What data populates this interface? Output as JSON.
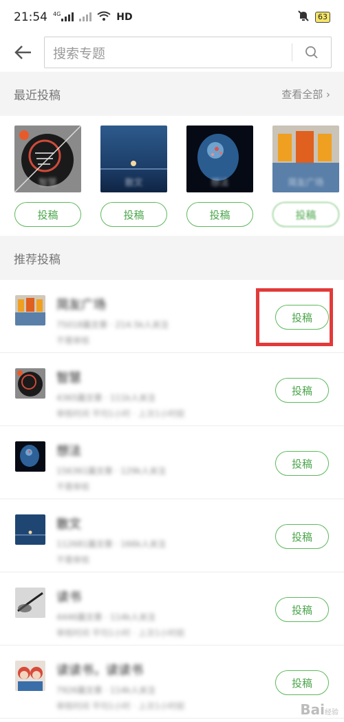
{
  "status_bar": {
    "time": "21:54",
    "network_label": "4G",
    "hd_label": "HD",
    "battery": "63"
  },
  "search": {
    "placeholder": "搜索专题"
  },
  "recent": {
    "title": "最近投稿",
    "view_all": "查看全部 ›",
    "items": [
      {
        "name": "智慧",
        "button": "投稿"
      },
      {
        "name": "散文",
        "button": "投稿"
      },
      {
        "name": "想法",
        "button": "投稿"
      },
      {
        "name": "简友广场",
        "button": "投稿"
      }
    ]
  },
  "recommend": {
    "title": "推荐投稿",
    "rows": [
      {
        "name": "简友广场",
        "meta": "75018篇文章 · 214.5k人关注",
        "meta2": "不需审核",
        "button": "投稿"
      },
      {
        "name": "智慧",
        "meta": "4365篇文章 · 111k人关注",
        "meta2": "审核时间 平均1小时 · 上次1小时前",
        "button": "投稿"
      },
      {
        "name": "想法",
        "meta": "156361篇文章 · 129k人关注",
        "meta2": "不需审核",
        "button": "投稿"
      },
      {
        "name": "散文",
        "meta": "112681篇文章 · 166k人关注",
        "meta2": "不需审核",
        "button": "投稿"
      },
      {
        "name": "读书",
        "meta": "4446篇文章 · 114k人关注",
        "meta2": "审核时间 平均1小时 · 上次1小时前",
        "button": "投稿"
      },
      {
        "name": "读读书，读读书",
        "meta": "7926篇文章 · 114k人关注",
        "meta2": "审核时间 平均1小时 · 上次1小时前",
        "button": "投稿"
      }
    ]
  },
  "watermark": {
    "text": "Bai",
    "suffix": "经验"
  },
  "colors": {
    "accent_green": "#4aa54a",
    "highlight_red": "#e23a3a"
  }
}
